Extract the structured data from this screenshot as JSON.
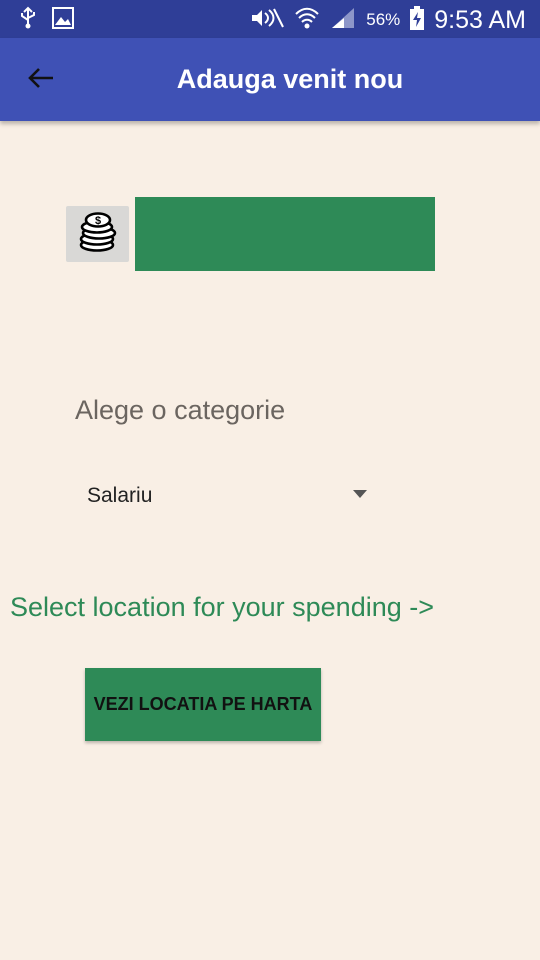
{
  "status_bar": {
    "battery": "56%",
    "time": "9:53 AM",
    "icons": [
      "usb-icon",
      "gallery-icon",
      "mute-icon",
      "wifi-icon",
      "signal-icon",
      "battery-charging-icon"
    ]
  },
  "app_bar": {
    "title": "Adauga venit nou",
    "back_icon": "back-arrow-icon",
    "color": "#3f51b5",
    "status_color": "#2f3e97"
  },
  "amount": {
    "icon": "coins-icon",
    "value": "",
    "color": "#2e8a57"
  },
  "category": {
    "label": "Alege o categorie",
    "selected": "Salariu"
  },
  "location": {
    "prompt": "Select location for your spending ->",
    "button_label": "VEZI LOCATIA PE HARTA"
  },
  "colors": {
    "background": "#f9efe5",
    "accent_green": "#2e8a57"
  }
}
